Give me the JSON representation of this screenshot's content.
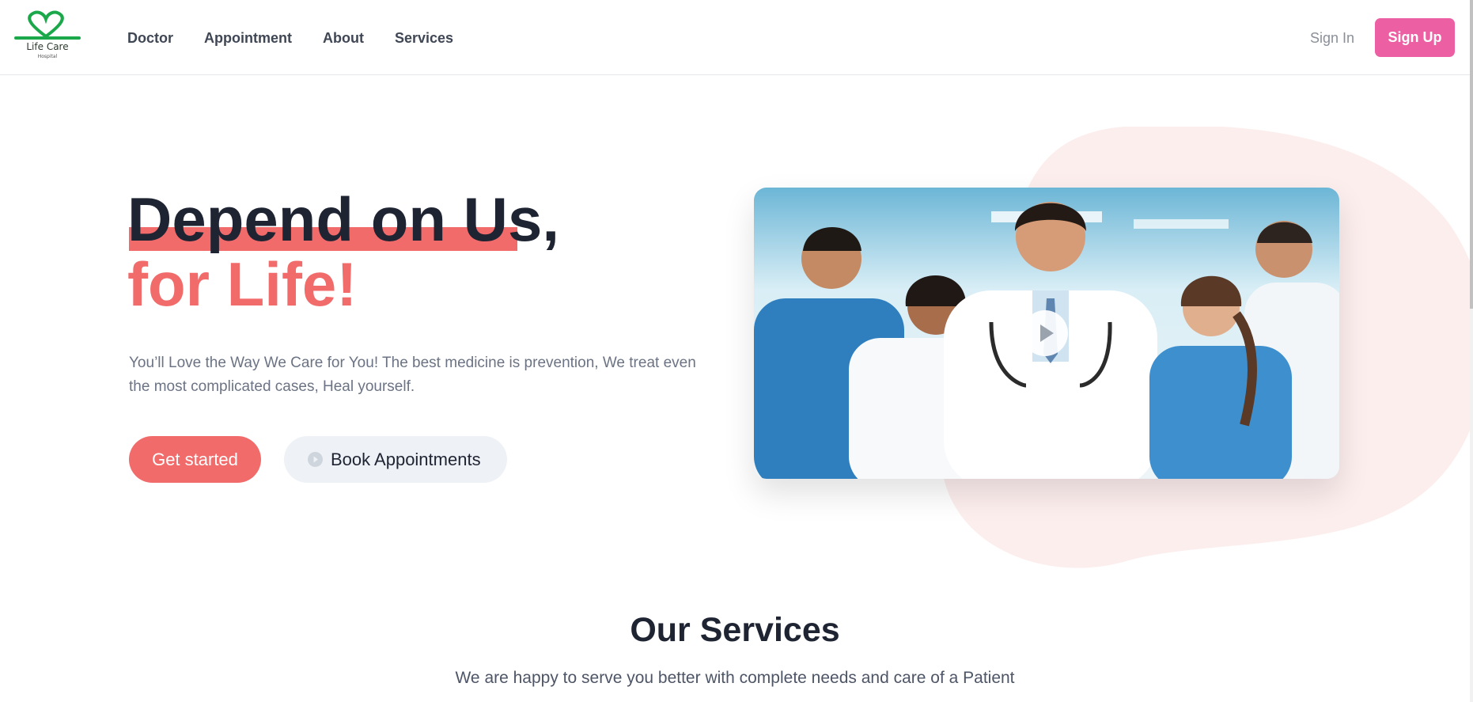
{
  "brand": {
    "name": "Life Care",
    "tagline": "Hospital",
    "logo_color": "#1aa84a"
  },
  "nav": {
    "links": [
      "Doctor",
      "Appointment",
      "About",
      "Services"
    ],
    "signin_label": "Sign In",
    "signup_label": "Sign Up"
  },
  "hero": {
    "headline_line1": "Depend on Us,",
    "headline_line2": "for Life!",
    "description": "You’ll Love the Way We Care for You! The best medicine is prevention, We treat even the most complicated cases, Heal yourself.",
    "primary_button": "Get started",
    "secondary_button": "Book Appointments",
    "image_icon": "play-icon",
    "accent_color": "#f26b6b"
  },
  "services": {
    "title": "Our Services",
    "subtitle": "We are happy to serve you better with complete needs and care of a Patient"
  },
  "colors": {
    "signup_bg": "#ec5fa3",
    "heading": "#1f2433",
    "blob": "#fdeeee"
  }
}
